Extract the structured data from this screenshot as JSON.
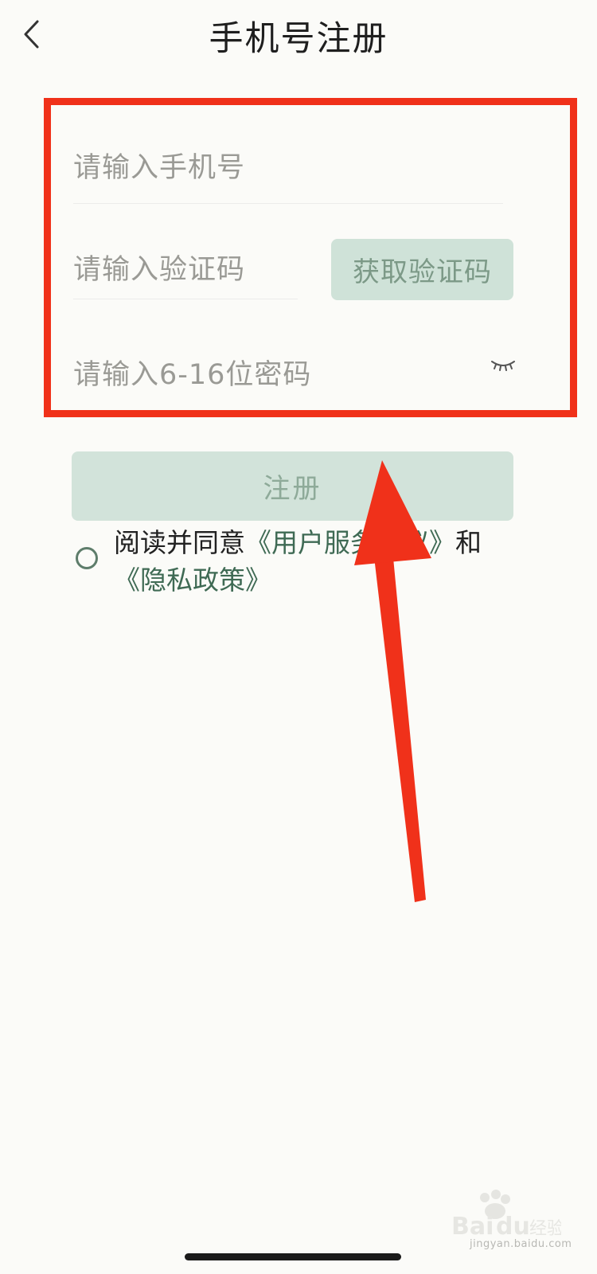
{
  "header": {
    "title": "手机号注册"
  },
  "form": {
    "phone_placeholder": "请输入手机号",
    "code_placeholder": "请输入验证码",
    "get_code_label": "获取验证码",
    "password_placeholder": "请输入6-16位密码"
  },
  "actions": {
    "register_label": "注册"
  },
  "agreement": {
    "prefix": "阅读并同意",
    "user_agreement": "《用户服务协议》",
    "conjunction": "和",
    "privacy_policy": "《隐私政策》"
  },
  "watermark": {
    "logo_text": "Baidu经验",
    "sub_text": "jingyan.baidu.com"
  },
  "colors": {
    "highlight_box": "#f0311a",
    "arrow": "#f0311a",
    "accent_green": "#3f6a54",
    "button_bg": "#d2e3da"
  },
  "icons": {
    "back": "chevron-left-icon",
    "password_visibility": "eye-closed-icon"
  }
}
